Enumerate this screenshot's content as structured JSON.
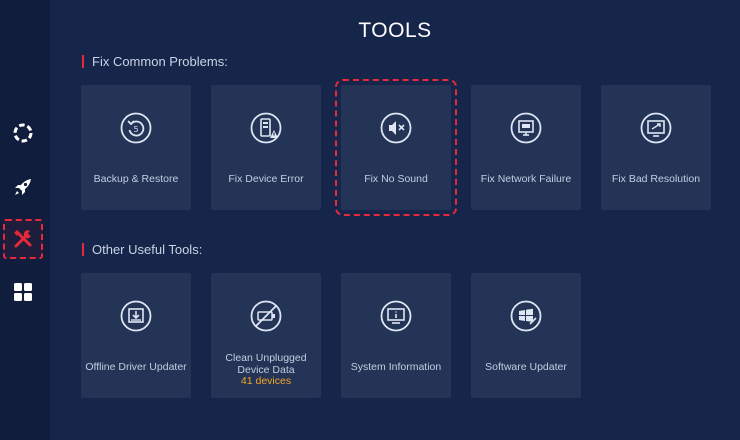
{
  "page": {
    "title": "TOOLS"
  },
  "sidebar": {
    "items": [
      {
        "name": "scan",
        "icon": "ring-icon"
      },
      {
        "name": "boost",
        "icon": "rocket-icon"
      },
      {
        "name": "tools",
        "icon": "tools-icon",
        "active": true
      },
      {
        "name": "apps",
        "icon": "grid-icon"
      }
    ]
  },
  "sections": {
    "fix_common": {
      "title": "Fix Common Problems:",
      "cards": [
        {
          "label": "Backup & Restore",
          "icon": "backup-restore-icon"
        },
        {
          "label": "Fix Device Error",
          "icon": "device-error-icon"
        },
        {
          "label": "Fix No Sound",
          "icon": "no-sound-icon",
          "selected": true
        },
        {
          "label": "Fix Network Failure",
          "icon": "network-failure-icon"
        },
        {
          "label": "Fix Bad Resolution",
          "icon": "bad-resolution-icon"
        }
      ]
    },
    "other_tools": {
      "title": "Other Useful Tools:",
      "cards": [
        {
          "label": "Offline Driver Updater",
          "icon": "offline-driver-icon"
        },
        {
          "label": "Clean Unplugged Device Data",
          "count": "41 devices",
          "icon": "unplugged-device-icon"
        },
        {
          "label": "System Information",
          "icon": "system-info-icon"
        },
        {
          "label": "Software Updater",
          "icon": "software-updater-icon"
        }
      ]
    }
  },
  "colors": {
    "background": "#16254a",
    "sidebar": "#111d3d",
    "card": "#233457",
    "accent_red": "#e8283b",
    "count_orange": "#f6a623"
  }
}
